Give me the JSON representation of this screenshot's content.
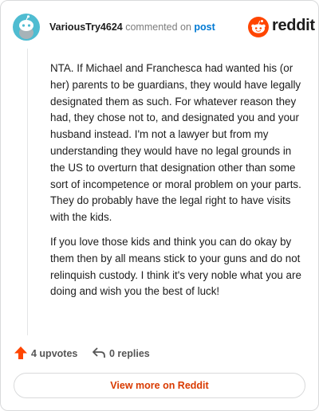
{
  "comment": {
    "author": "VariousTry4624",
    "action_text": "commented on",
    "post_link": "post",
    "paragraphs": [
      "NTA. If Michael and Franchesca had wanted his (or her) parents to be guardians, they would have legally designated them as such. For whatever reason they had, they chose not to, and designated you and your husband instead. I'm not a lawyer but from my understanding they would have no legal grounds in the US to overturn that designation other than some sort of incompetence or moral problem on your parts. They do probably have the legal right to have visits with the kids.",
      "If you love those kids and think you can do okay by them then by all means stick to your guns and do not relinquish custody. I think it's very noble what you are doing and wish you the best of luck!"
    ],
    "upvotes": "4 upvotes",
    "replies": "0 replies"
  },
  "brand": {
    "name": "reddit",
    "icon": "reddit-logo-icon",
    "color": "#ff4500"
  },
  "footer": {
    "view_more": "View more on Reddit"
  },
  "colors": {
    "accent": "#0079d3",
    "upvote": "#ff4500",
    "button_text": "#d93a00",
    "avatar_bg": "#4fbcd1"
  }
}
